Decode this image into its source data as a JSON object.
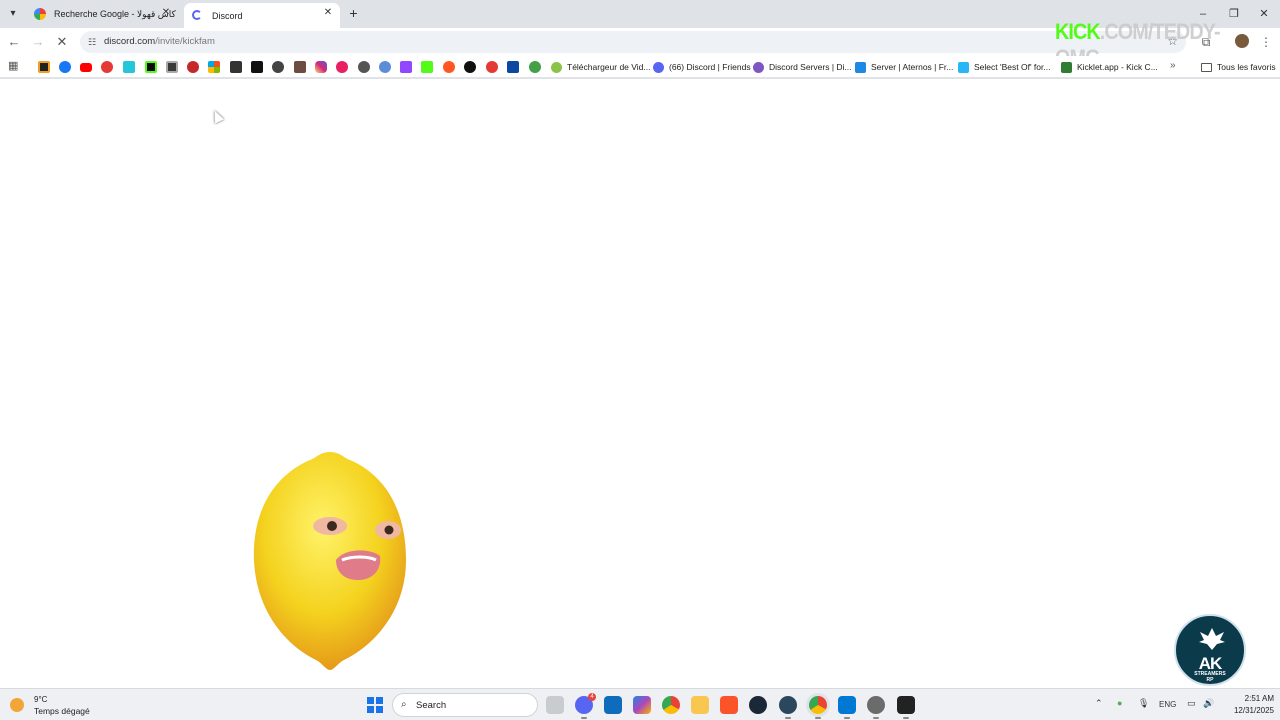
{
  "browser": {
    "tabs": [
      {
        "label": "Recherche Google - كاس قهولا",
        "favicon": "google-icon"
      },
      {
        "label": "Discord",
        "favicon": "discord-loading-icon"
      }
    ],
    "url": {
      "host": "discord.com",
      "path": "/invite/kickfam"
    },
    "overlay": {
      "brand": "KICK",
      "rest": ".COM/TEDDY-OMG"
    },
    "bookmarks": [
      {
        "label": "Téléchargeur de Vid...",
        "icon": "android-icon"
      },
      {
        "label": "(66) Discord | Friends",
        "icon": "discord-icon"
      },
      {
        "label": "Discord Servers | Di...",
        "icon": "discord-servers-icon"
      },
      {
        "label": "Server | Aternos | Fr...",
        "icon": "aternos-icon"
      },
      {
        "label": "Select 'Best Of' for...",
        "icon": "bow-icon"
      },
      {
        "label": "Kicklet.app - Kick C...",
        "icon": "kicklet-icon"
      }
    ],
    "all_bookmarks": "Tous les favoris"
  },
  "stream_logo": {
    "main": "AK",
    "sub": "STREAMERS",
    "sub2": "RP"
  },
  "taskbar": {
    "weather": {
      "temp": "9°C",
      "condition": "Temps dégagé"
    },
    "search_label": "Search",
    "discord_badge": "4",
    "language": "ENG",
    "time": "2:51 AM",
    "date": "12/31/2025"
  },
  "colors": {
    "kick_green": "#53fc18",
    "chrome_frame": "#dfe3e8",
    "taskbar": "#eef0f4",
    "windows_blue": "#1a73e8"
  }
}
